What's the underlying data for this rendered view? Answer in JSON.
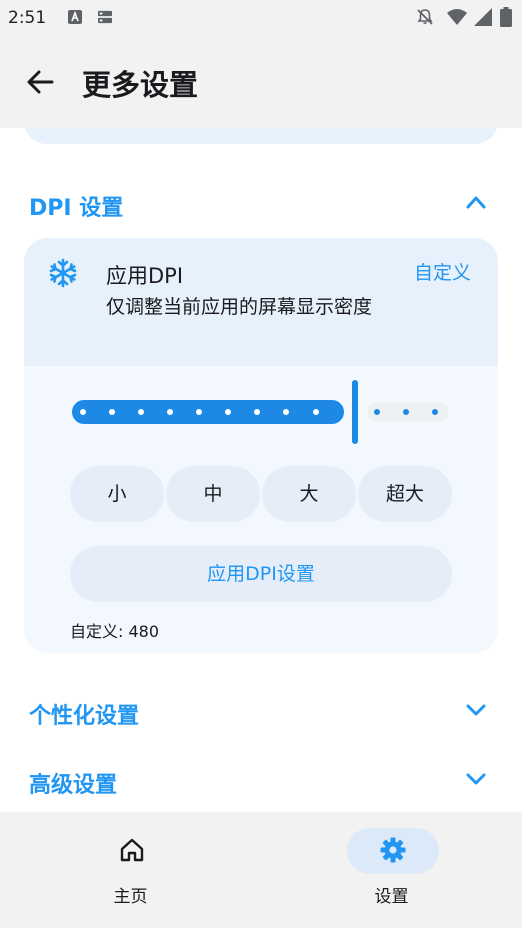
{
  "status": {
    "time": "2:51"
  },
  "appbar": {
    "title": "更多设置"
  },
  "dpi": {
    "section_title": "DPI 设置",
    "card_title": "应用DPI",
    "card_subtitle": "仅调整当前应用的屏幕显示密度",
    "custom_link": "自定义",
    "slider_level": 0.8,
    "sizes": [
      "小",
      "中",
      "大",
      "超大"
    ],
    "apply_label": "应用DPI设置",
    "custom_value": "自定义: 480"
  },
  "sections": [
    {
      "title": "个性化设置"
    },
    {
      "title": "高级设置"
    }
  ],
  "nav": {
    "home_label": "主页",
    "settings_label": "设置"
  },
  "colors": {
    "accent": "#2196f3",
    "track": "#1e88e5",
    "card": "#e7f1fb"
  }
}
